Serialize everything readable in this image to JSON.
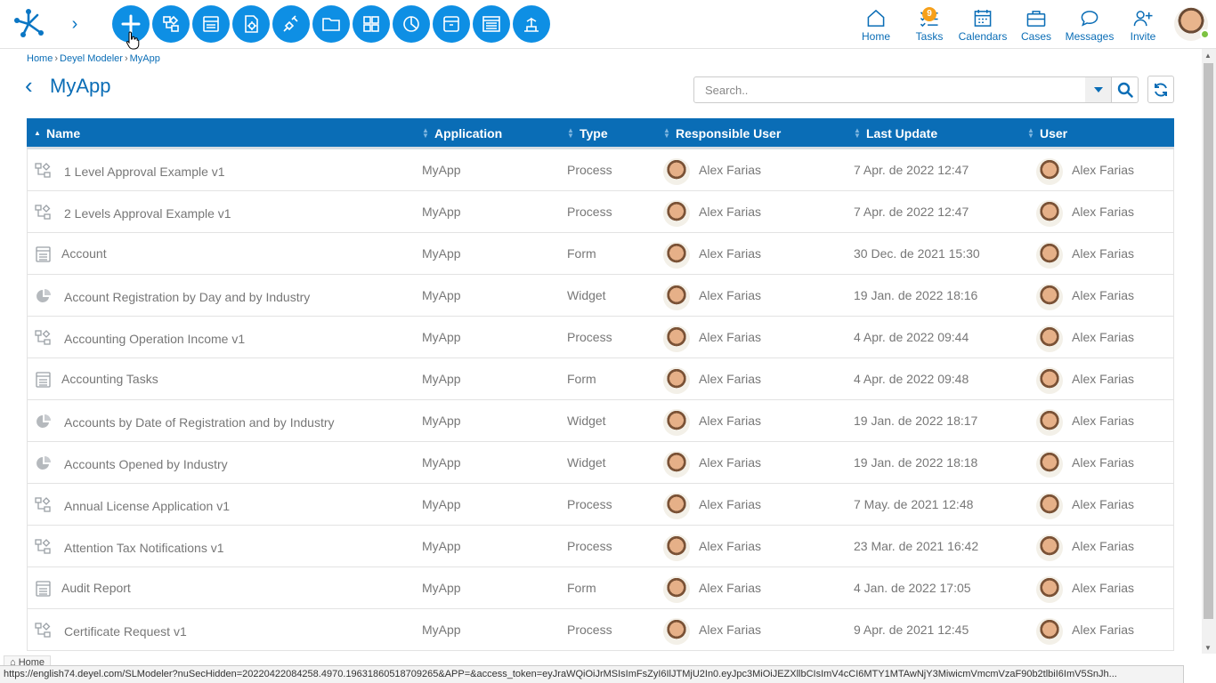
{
  "app": {
    "title": "MyApp"
  },
  "breadcrumb": [
    "Home",
    "Deyel Modeler",
    "MyApp"
  ],
  "toolbar": {
    "buttons": [
      "add-icon",
      "process-icon",
      "form-icon",
      "rule-icon",
      "integration-icon",
      "folder-icon",
      "dashboard-icon",
      "widget-icon",
      "archive-icon",
      "report-icon",
      "model-icon"
    ]
  },
  "nav": {
    "home": "Home",
    "tasks": "Tasks",
    "tasks_badge": "9",
    "calendars": "Calendars",
    "cases": "Cases",
    "messages": "Messages",
    "invite": "Invite"
  },
  "search": {
    "placeholder": "Search.."
  },
  "table": {
    "columns": [
      "Name",
      "Application",
      "Type",
      "Responsible User",
      "Last Update",
      "User"
    ],
    "rows": [
      {
        "icon": "process-icon",
        "name": "1 Level Approval Example v1",
        "application": "MyApp",
        "type": "Process",
        "responsible": "Alex Farias",
        "updated": "7 Apr. de 2022 12:47",
        "user": "Alex Farias"
      },
      {
        "icon": "process-icon",
        "name": "2 Levels Approval Example v1",
        "application": "MyApp",
        "type": "Process",
        "responsible": "Alex Farias",
        "updated": "7 Apr. de 2022 12:47",
        "user": "Alex Farias"
      },
      {
        "icon": "form-icon",
        "name": "Account",
        "application": "MyApp",
        "type": "Form",
        "responsible": "Alex Farias",
        "updated": "30 Dec. de 2021 15:30",
        "user": "Alex Farias"
      },
      {
        "icon": "widget-icon",
        "name": "Account Registration by Day and by Industry",
        "application": "MyApp",
        "type": "Widget",
        "responsible": "Alex Farias",
        "updated": "19 Jan. de 2022 18:16",
        "user": "Alex Farias"
      },
      {
        "icon": "process-icon",
        "name": "Accounting Operation Income v1",
        "application": "MyApp",
        "type": "Process",
        "responsible": "Alex Farias",
        "updated": "4 Apr. de 2022 09:44",
        "user": "Alex Farias"
      },
      {
        "icon": "form-icon",
        "name": "Accounting Tasks",
        "application": "MyApp",
        "type": "Form",
        "responsible": "Alex Farias",
        "updated": "4 Apr. de 2022 09:48",
        "user": "Alex Farias"
      },
      {
        "icon": "widget-icon",
        "name": "Accounts by Date of Registration and by Industry",
        "application": "MyApp",
        "type": "Widget",
        "responsible": "Alex Farias",
        "updated": "19 Jan. de 2022 18:17",
        "user": "Alex Farias"
      },
      {
        "icon": "widget-icon",
        "name": "Accounts Opened by Industry",
        "application": "MyApp",
        "type": "Widget",
        "responsible": "Alex Farias",
        "updated": "19 Jan. de 2022 18:18",
        "user": "Alex Farias"
      },
      {
        "icon": "process-icon",
        "name": "Annual License Application v1",
        "application": "MyApp",
        "type": "Process",
        "responsible": "Alex Farias",
        "updated": "7 May. de 2021 12:48",
        "user": "Alex Farias"
      },
      {
        "icon": "process-icon",
        "name": "Attention Tax Notifications v1",
        "application": "MyApp",
        "type": "Process",
        "responsible": "Alex Farias",
        "updated": "23 Mar. de 2021 16:42",
        "user": "Alex Farias"
      },
      {
        "icon": "form-icon",
        "name": "Audit Report",
        "application": "MyApp",
        "type": "Form",
        "responsible": "Alex Farias",
        "updated": "4 Jan. de 2022 17:05",
        "user": "Alex Farias"
      },
      {
        "icon": "process-icon",
        "name": "Certificate Request v1",
        "application": "MyApp",
        "type": "Process",
        "responsible": "Alex Farias",
        "updated": "9 Apr. de 2021 12:45",
        "user": "Alex Farias"
      }
    ]
  },
  "statusbar": {
    "home_chip": "Home",
    "url": "https://english74.deyel.com/SLModeler?nuSecHidden=20220422084258.4970.19631860518709265&APP=&access_token=eyJraWQiOiJrMSIsImFsZyI6IlJTMjU2In0.eyJpc3MiOiJEZXllbCIsImV4cCI6MTY1MTAwNjY3MiwicmVmcmVzaF90b2tlbiI6ImV5SnJh..."
  },
  "colors": {
    "brand": "#0a6db6",
    "accent": "#0e8fe4",
    "badge": "#f6a01a"
  }
}
